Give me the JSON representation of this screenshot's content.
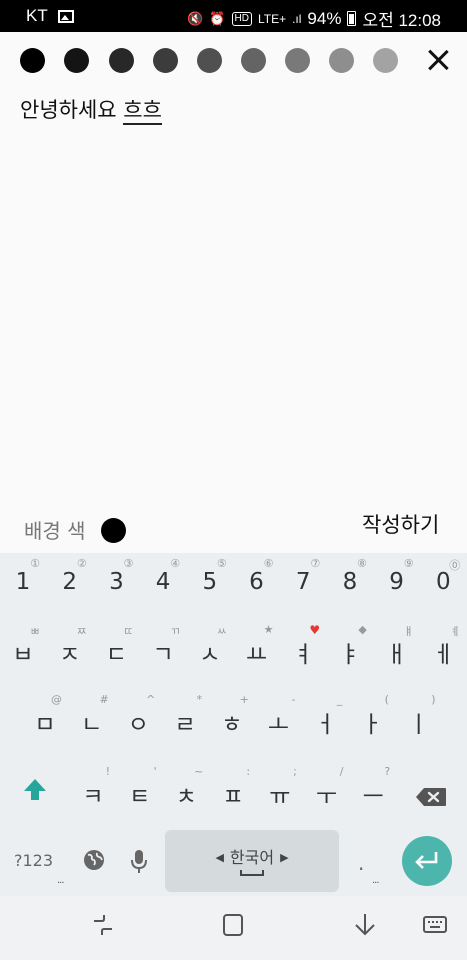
{
  "status_bar": {
    "carrier": "KT",
    "lte": "LTE+",
    "battery": "94%",
    "time": "오전 12:08",
    "hd": "HD"
  },
  "palette": {
    "colors": [
      "#000000",
      "#141414",
      "#282828",
      "#3c3c3c",
      "#505050",
      "#646464",
      "#797979",
      "#8e8e8e",
      "#a3a3a3"
    ]
  },
  "memo": {
    "text": "안녕하세요 ",
    "composing": "흐흐"
  },
  "controls": {
    "background_color_label": "배경 색",
    "background_color": "#000000",
    "write_button": "작성하기"
  },
  "keyboard": {
    "row1": [
      {
        "main": "1",
        "sub": "①"
      },
      {
        "main": "2",
        "sub": "②"
      },
      {
        "main": "3",
        "sub": "③"
      },
      {
        "main": "4",
        "sub": "④"
      },
      {
        "main": "5",
        "sub": "⑤"
      },
      {
        "main": "6",
        "sub": "⑥"
      },
      {
        "main": "7",
        "sub": "⑦"
      },
      {
        "main": "8",
        "sub": "⑧"
      },
      {
        "main": "9",
        "sub": "⑨"
      },
      {
        "main": "0",
        "sub": "⓪"
      }
    ],
    "row2": [
      {
        "main": "ㅂ",
        "sub": "ㅃ"
      },
      {
        "main": "ㅈ",
        "sub": "ㅉ"
      },
      {
        "main": "ㄷ",
        "sub": "ㄸ"
      },
      {
        "main": "ㄱ",
        "sub": "ㄲ"
      },
      {
        "main": "ㅅ",
        "sub": "ㅆ"
      },
      {
        "main": "ㅛ",
        "sub": "★"
      },
      {
        "main": "ㅕ",
        "sub": "♥"
      },
      {
        "main": "ㅑ",
        "sub": "◆"
      },
      {
        "main": "ㅐ",
        "sub": "ㅒ"
      },
      {
        "main": "ㅔ",
        "sub": "ㅖ"
      }
    ],
    "row3": [
      {
        "main": "ㅁ",
        "sub": "@"
      },
      {
        "main": "ㄴ",
        "sub": "#"
      },
      {
        "main": "ㅇ",
        "sub": "^"
      },
      {
        "main": "ㄹ",
        "sub": "*"
      },
      {
        "main": "ㅎ",
        "sub": "+"
      },
      {
        "main": "ㅗ",
        "sub": "-"
      },
      {
        "main": "ㅓ",
        "sub": "_"
      },
      {
        "main": "ㅏ",
        "sub": "("
      },
      {
        "main": "ㅣ",
        "sub": ")"
      }
    ],
    "row4": [
      {
        "main": "ㅋ",
        "sub": "!"
      },
      {
        "main": "ㅌ",
        "sub": "'"
      },
      {
        "main": "ㅊ",
        "sub": "~"
      },
      {
        "main": "ㅍ",
        "sub": ":"
      },
      {
        "main": "ㅠ",
        "sub": ";"
      },
      {
        "main": "ㅜ",
        "sub": "/"
      },
      {
        "main": "ㅡ",
        "sub": "?"
      }
    ],
    "symbols_key": "?123",
    "space_label": "한국어",
    "period": "."
  },
  "icons": {
    "close": "close-icon",
    "shift": "shift-arrow-icon",
    "backspace": "backspace-icon",
    "globe": "globe-icon",
    "mic": "microphone-icon",
    "enter": "enter-icon",
    "nav_recent": "recent-apps-icon",
    "nav_home": "home-icon",
    "nav_back": "back-icon",
    "nav_keyboard": "keyboard-icon"
  },
  "colors": {
    "accent": "#4db6ac",
    "shift": "#26a69a",
    "heart": "#e53935"
  }
}
